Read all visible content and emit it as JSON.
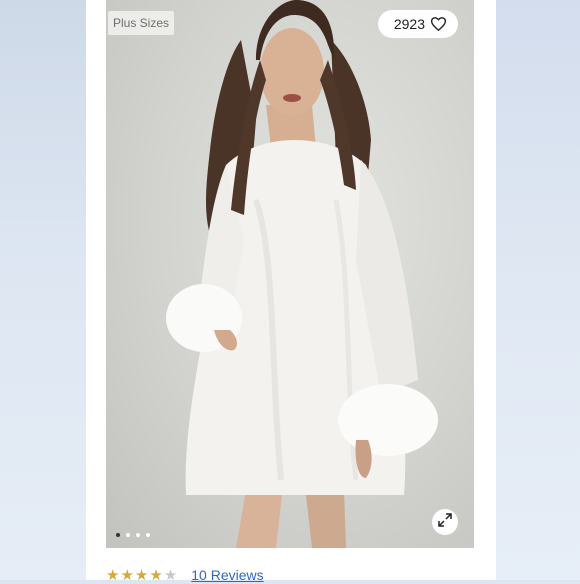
{
  "badge": {
    "label": "Plus Sizes"
  },
  "likes": {
    "count": "2923",
    "icon": "heart-outline-icon"
  },
  "carousel": {
    "total_images": 4,
    "active_index": 0
  },
  "expand": {
    "icon": "expand-icon"
  },
  "rating": {
    "value": 4,
    "max": 5,
    "reviews_label": "10 Reviews"
  },
  "colors": {
    "star": "#d4ab3a",
    "star_empty": "#c8c8c8",
    "link": "#2f67c2"
  }
}
